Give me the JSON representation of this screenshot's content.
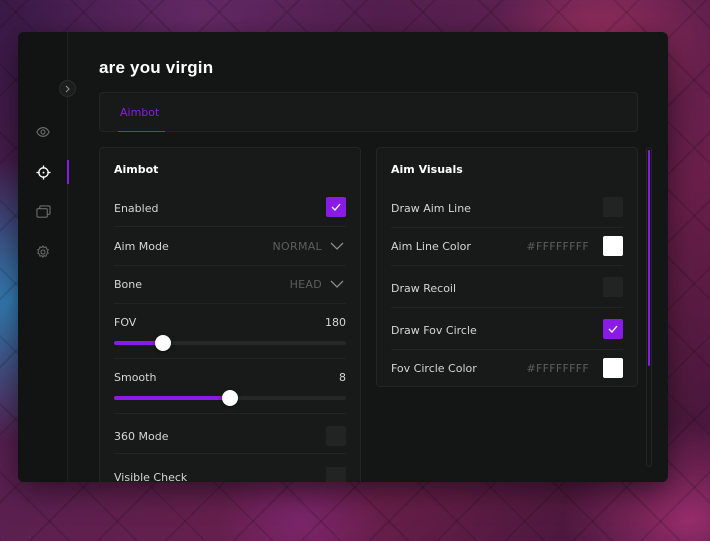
{
  "window": {
    "title": "are you virgin"
  },
  "sidebar": {
    "items": [
      {
        "icon": "eye-icon"
      },
      {
        "icon": "crosshair-icon",
        "active": true
      },
      {
        "icon": "layers-icon"
      },
      {
        "icon": "gear-icon"
      }
    ]
  },
  "tabs": [
    {
      "label": "Aimbot",
      "active": true
    }
  ],
  "aimbot": {
    "title": "Aimbot",
    "enabled": {
      "label": "Enabled",
      "checked": true
    },
    "aim_mode": {
      "label": "Aim Mode",
      "value": "NORMAL"
    },
    "bone": {
      "label": "Bone",
      "value": "HEAD"
    },
    "fov": {
      "label": "FOV",
      "value": "180",
      "fraction": 0.21
    },
    "smooth": {
      "label": "Smooth",
      "value": "8",
      "fraction": 0.5
    },
    "mode_360": {
      "label": "360 Mode",
      "checked": false
    },
    "visible_check": {
      "label": "Visible Check",
      "checked": false
    }
  },
  "aim_visuals": {
    "title": "Aim Visuals",
    "draw_aim_line": {
      "label": "Draw Aim Line",
      "checked": false
    },
    "aim_line_color": {
      "label": "Aim Line Color",
      "hex": "#FFFFFFFF",
      "color": "#FFFFFF"
    },
    "draw_recoil": {
      "label": "Draw Recoil",
      "checked": false
    },
    "draw_fov_circle": {
      "label": "Draw Fov Circle",
      "checked": true
    },
    "fov_circle_color": {
      "label": "Fov Circle Color",
      "hex": "#FFFFFFFF",
      "color": "#FFFFFF"
    }
  },
  "colors": {
    "accent": "#8A1BE6",
    "background": "#141515",
    "panel": "#181919"
  }
}
